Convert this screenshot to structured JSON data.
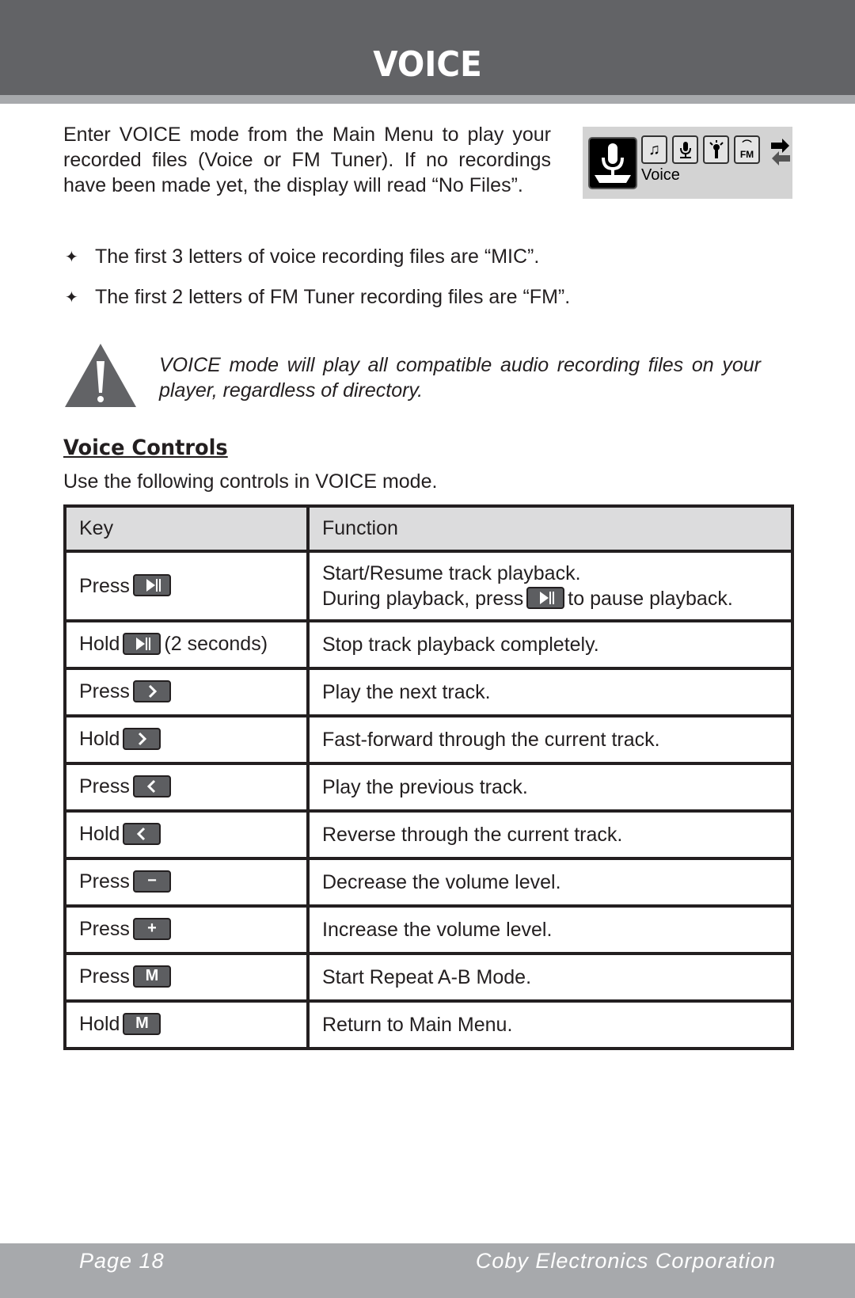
{
  "header": {
    "title": "VOICE"
  },
  "intro": {
    "text": "Enter VOICE mode from the Main Menu to play your recorded files (Voice or FM Tuner). If no recordings have been made yet, the display will read “No Files”."
  },
  "screen": {
    "label": "Voice",
    "icons": [
      "microphone-icon",
      "music-note-icon",
      "record-icon",
      "flashlight-icon",
      "fm-radio-icon",
      "swap-arrows-icon"
    ]
  },
  "bullets": [
    "The first 3 letters of voice recording files are “MIC”.",
    "The first 2 letters of FM Tuner recording files are “FM”."
  ],
  "warning": {
    "text": "VOICE mode will play all compatible audio recording files on your player, regardless of directory."
  },
  "section": {
    "title": "Voice Controls",
    "subtitle": "Use the following controls in VOICE mode."
  },
  "table": {
    "headers": [
      "Key",
      "Function"
    ],
    "rows": [
      {
        "action": "Press",
        "button": "play-pause",
        "suffix": "",
        "function": "Start/Resume track playback.",
        "function2_pre": "During playback, press",
        "function2_post": "to pause playback."
      },
      {
        "action": "Hold",
        "button": "play-pause",
        "suffix": "(2 seconds)",
        "function": "Stop track playback completely."
      },
      {
        "action": "Press",
        "button": "next",
        "suffix": "",
        "function": "Play the next track."
      },
      {
        "action": "Hold",
        "button": "next",
        "suffix": "",
        "function": "Fast-forward through the current track."
      },
      {
        "action": "Press",
        "button": "previous",
        "suffix": "",
        "function": "Play the previous track."
      },
      {
        "action": "Hold",
        "button": "previous",
        "suffix": "",
        "function": "Reverse through the current track."
      },
      {
        "action": "Press",
        "button": "minus",
        "button_label": "−",
        "suffix": "",
        "function": "Decrease the volume level."
      },
      {
        "action": "Press",
        "button": "plus",
        "button_label": "+",
        "suffix": "",
        "function": "Increase the volume level."
      },
      {
        "action": "Press",
        "button": "menu",
        "button_label": "M",
        "suffix": "",
        "function": "Start Repeat A-B Mode."
      },
      {
        "action": "Hold",
        "button": "menu",
        "button_label": "M",
        "suffix": "",
        "function": "Return to Main Menu."
      }
    ]
  },
  "footer": {
    "page": "Page 18",
    "company": "Coby Electronics Corporation"
  },
  "colors": {
    "header_bg": "#626366",
    "strip_bg": "#a7a9ac",
    "footer_bg": "#a7a9ac",
    "table_header_bg": "#dcdcdd",
    "button_bg": "#5d5e61",
    "text": "#231f20"
  }
}
